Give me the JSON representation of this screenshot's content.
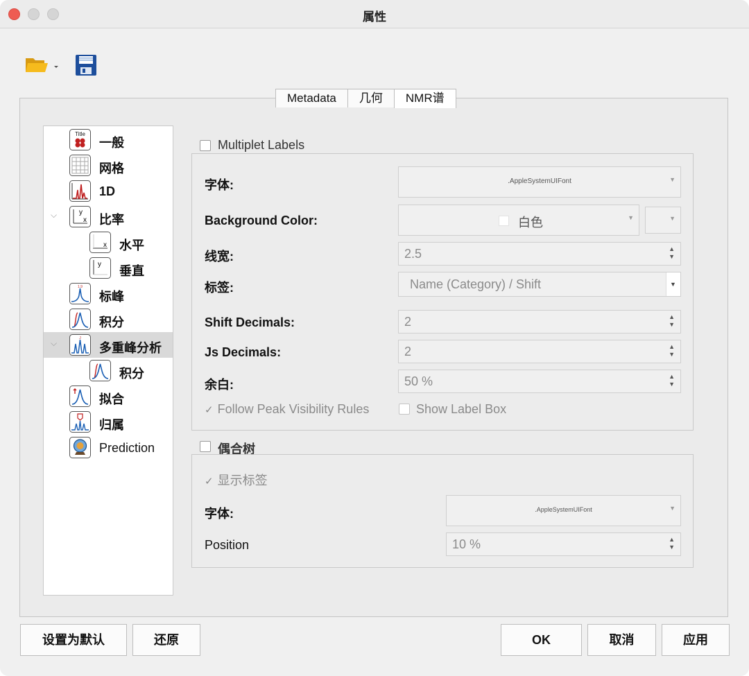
{
  "window": {
    "title": "属性"
  },
  "toolbar": {
    "open_icon": "folder-open-icon",
    "save_icon": "floppy-save-icon"
  },
  "tabs": [
    {
      "label": "Metadata"
    },
    {
      "label": "几何"
    },
    {
      "label": "NMR谱"
    }
  ],
  "tree": {
    "items": [
      {
        "label": "一般",
        "icon": "title-icon"
      },
      {
        "label": "网格",
        "icon": "grid-icon"
      },
      {
        "label": "1D",
        "icon": "spectrum-1d-icon"
      },
      {
        "label": "比率",
        "icon": "axes-icon"
      },
      {
        "label": "水平",
        "icon": "x-axis-icon"
      },
      {
        "label": "垂直",
        "icon": "y-axis-icon"
      },
      {
        "label": "标峰",
        "icon": "peak-label-icon"
      },
      {
        "label": "积分",
        "icon": "integral-icon"
      },
      {
        "label": "多重峰分析",
        "icon": "multiplet-icon"
      },
      {
        "label": "积分",
        "icon": "integral-icon"
      },
      {
        "label": "拟合",
        "icon": "fit-icon"
      },
      {
        "label": "归属",
        "icon": "assignment-icon"
      },
      {
        "label": "Prediction",
        "icon": "prediction-icon"
      }
    ]
  },
  "multiplet": {
    "title": "Multiplet Labels",
    "font_label": "字体:",
    "font_value": ".AppleSystemUIFont",
    "bg_label": "Background Color:",
    "bg_value": "白色",
    "linewidth_label": "线宽:",
    "linewidth_value": "2.5",
    "tag_label": "标签:",
    "tag_value": "Name (Category) / Shift",
    "shift_dec_label": "Shift Decimals:",
    "shift_dec_value": "2",
    "js_dec_label": "Js Decimals:",
    "js_dec_value": "2",
    "margin_label": "余白:",
    "margin_value": "50 %",
    "follow_label": "Follow Peak Visibility Rules",
    "showbox_label": "Show Label Box"
  },
  "coupling": {
    "title": "偶合树",
    "show_label": "显示标签",
    "font_label": "字体:",
    "font_value": ".AppleSystemUIFont",
    "position_label": "Position",
    "position_value": "10 %"
  },
  "buttons": {
    "set_default": "设置为默认",
    "restore": "还原",
    "ok": "OK",
    "cancel": "取消",
    "apply": "应用"
  }
}
